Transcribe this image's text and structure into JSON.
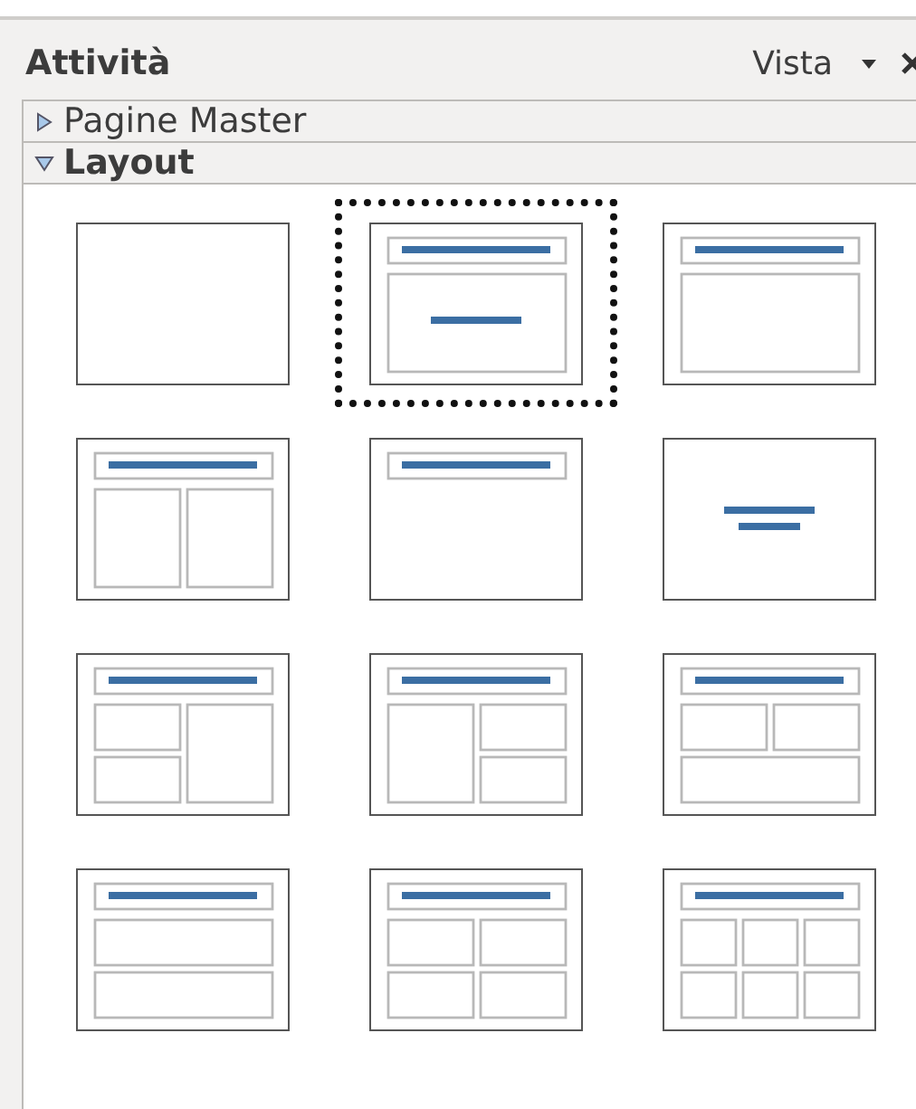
{
  "panel": {
    "title": "Attività",
    "view_menu": "Vista"
  },
  "sections": [
    {
      "label": "Pagine Master",
      "expanded": false
    },
    {
      "label": "Layout",
      "expanded": true
    }
  ],
  "layouts": [
    {
      "kind": "blank",
      "selected": false
    },
    {
      "kind": "title-content",
      "selected": true
    },
    {
      "kind": "title-box",
      "selected": false
    },
    {
      "kind": "title-two-columns",
      "selected": false
    },
    {
      "kind": "title-only",
      "selected": false
    },
    {
      "kind": "centered-text",
      "selected": false
    },
    {
      "kind": "title-left-stack-right",
      "selected": false
    },
    {
      "kind": "title-left-right-stack",
      "selected": false
    },
    {
      "kind": "title-two-top-wide-bottom",
      "selected": false
    },
    {
      "kind": "title-two-rows",
      "selected": false
    },
    {
      "kind": "title-grid-four",
      "selected": false
    },
    {
      "kind": "title-grid-six",
      "selected": false
    }
  ]
}
